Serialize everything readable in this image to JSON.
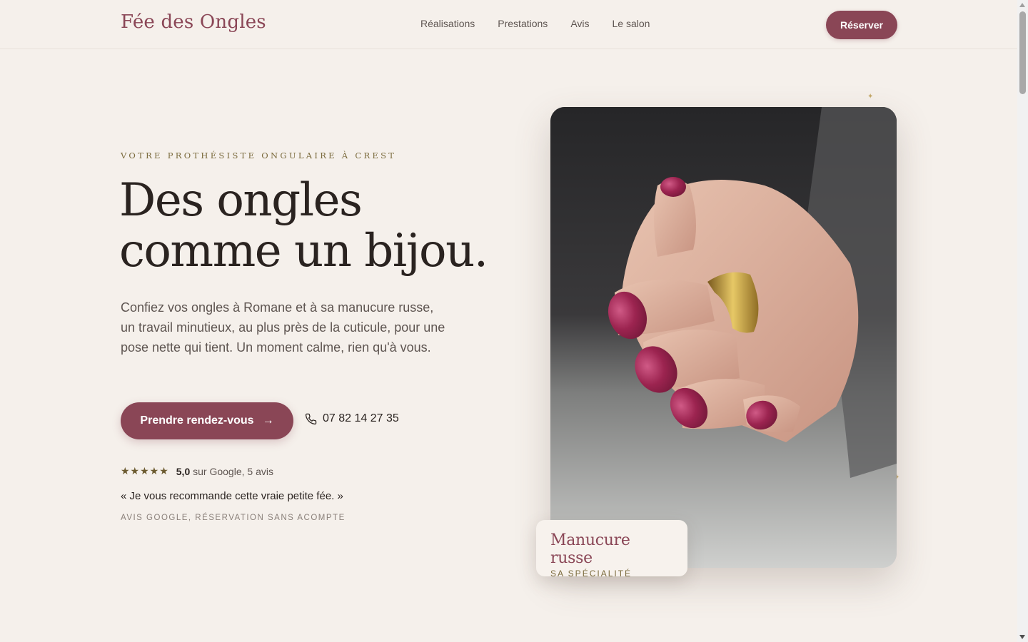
{
  "header": {
    "logo": "Fée des Ongles",
    "nav": [
      {
        "label": "Réalisations"
      },
      {
        "label": "Prestations"
      },
      {
        "label": "Avis"
      },
      {
        "label": "Le salon"
      }
    ],
    "reserve_label": "Réserver"
  },
  "hero": {
    "eyebrow": "VOTRE PROTHÉSISTE ONGULAIRE À CREST",
    "title_line1": "Des ongles",
    "title_line2": "comme un bijou.",
    "lead": "Confiez vos ongles à Romane et à sa manucure russe, un travail minutieux, au plus près de la cuticule, pour une pose nette qui tient. Un moment calme, rien qu'à vous.",
    "cta_label": "Prendre rendez-vous",
    "phone": "07 82 14 27 35",
    "stars": "★★★★★",
    "rating_score": "5,0",
    "rating_text": "sur Google, 5 avis",
    "quote": "« Je vous recommande cette vraie petite fée. »",
    "source": "AVIS GOOGLE, RÉSERVATION SANS ACOMPTE"
  },
  "badge": {
    "title": "Manucure russe",
    "subtitle": "SA SPÉCIALITÉ"
  },
  "colors": {
    "accent": "#8a4656",
    "background": "#f5f0eb",
    "gold": "#7a6a3c"
  }
}
